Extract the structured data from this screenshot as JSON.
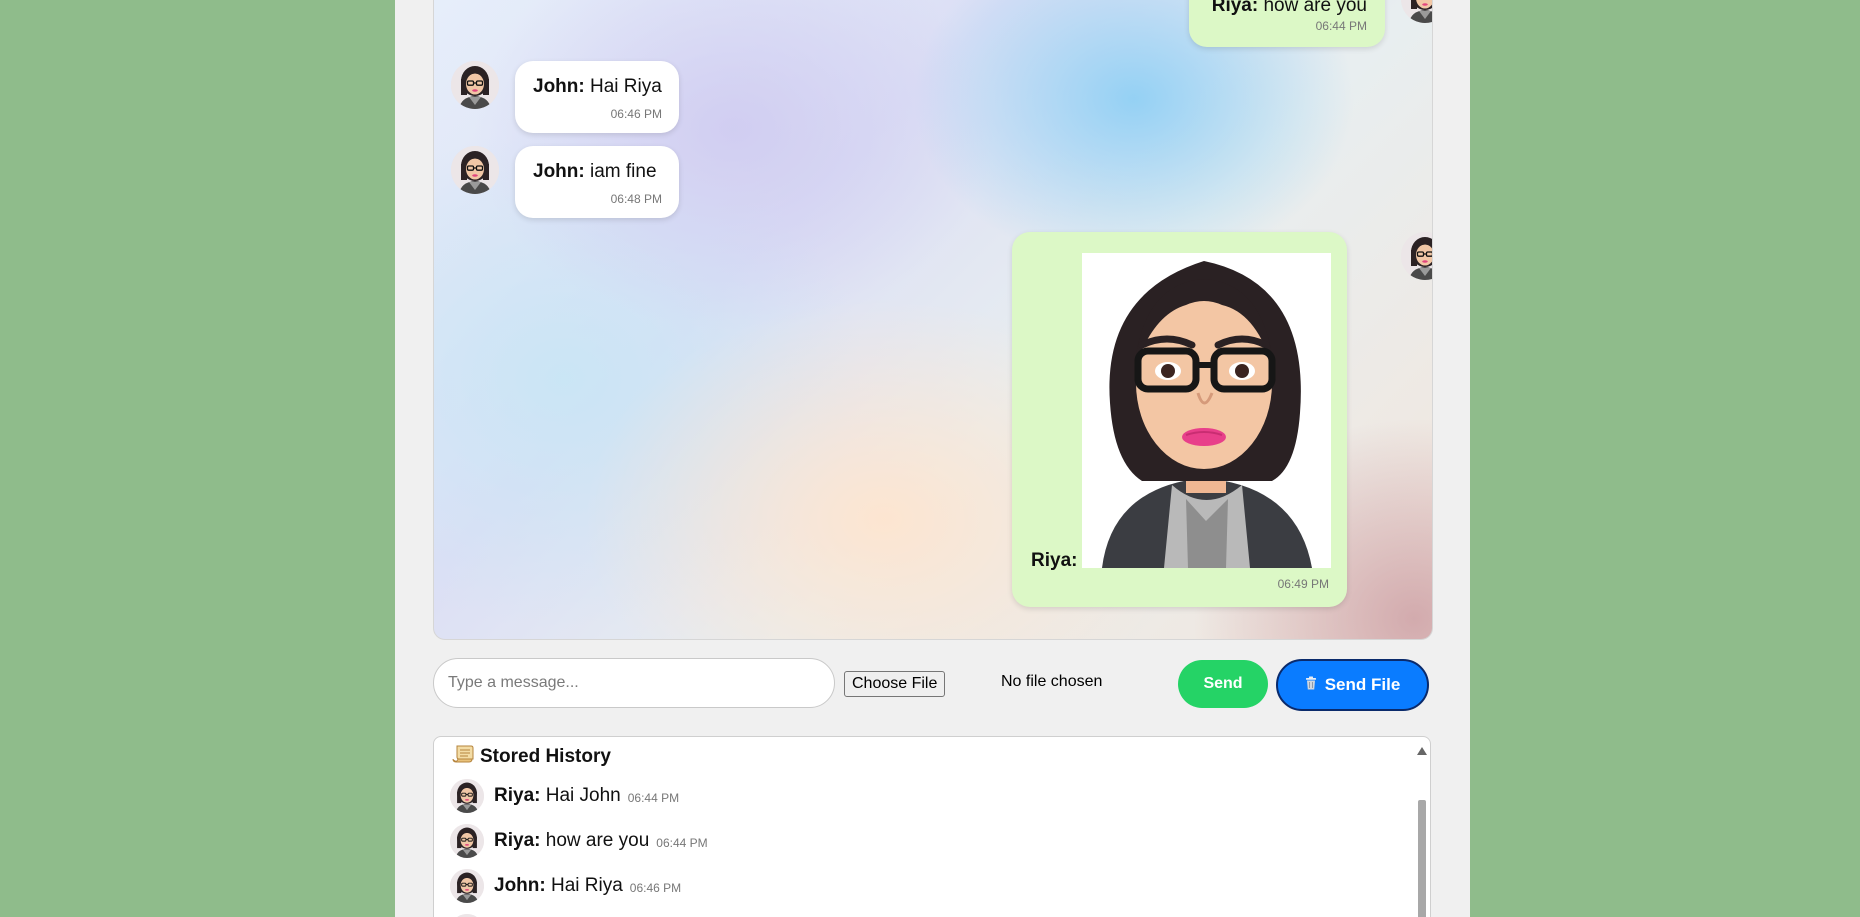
{
  "chat": {
    "messages": [
      {
        "sender": "Riya:",
        "text": " how are you",
        "time": "06:44 PM",
        "direction": "out"
      },
      {
        "sender": "John:",
        "text": " Hai Riya",
        "time": "06:46 PM",
        "direction": "in"
      },
      {
        "sender": "John:",
        "text": " iam fine",
        "time": "06:48 PM",
        "direction": "in"
      },
      {
        "sender": "Riya:",
        "text": "",
        "time": "06:49 PM",
        "direction": "out",
        "attachment": "avatar-photo"
      }
    ]
  },
  "composer": {
    "placeholder": "Type a message...",
    "choose_file_label": "Choose File",
    "no_file_label": "No file chosen",
    "send_label": "Send",
    "send_file_label": "Send File",
    "send_file_icon": "trash-icon"
  },
  "history": {
    "title": "Stored History",
    "title_icon": "scroll-icon",
    "items": [
      {
        "sender": "Riya:",
        "text": " Hai John",
        "time": "06:44 PM"
      },
      {
        "sender": "Riya:",
        "text": " how are you",
        "time": "06:44 PM"
      },
      {
        "sender": "John:",
        "text": " Hai Riya",
        "time": "06:46 PM"
      }
    ]
  },
  "colors": {
    "page_background": "#8fbc8b",
    "outgoing_bubble": "#dcf8c6",
    "incoming_bubble": "#ffffff",
    "send_button": "#25d366",
    "send_file_button": "#0a7cff"
  }
}
